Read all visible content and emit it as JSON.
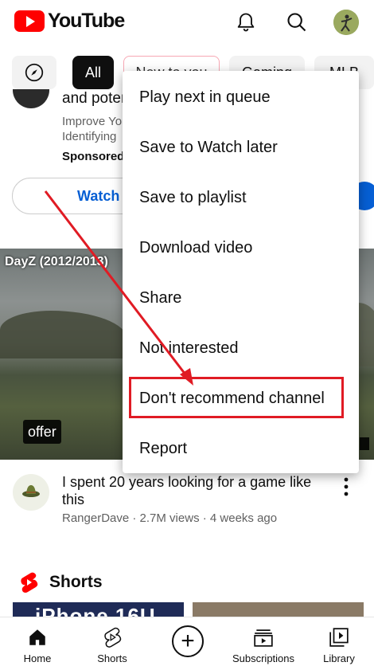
{
  "header": {
    "logo_text": "YouTube"
  },
  "chips": {
    "all": "All",
    "new": "New to you",
    "gaming": "Gaming",
    "mlb": "MLB"
  },
  "ad": {
    "title": "and poter",
    "desc": "Improve Yo Identifying",
    "sponsored": "Sponsored",
    "watch": "Watch"
  },
  "video": {
    "thumb_title": "DayZ (2012/2013)",
    "badge": "offer",
    "title": "I spent 20 years looking for a game like this",
    "meta": "RangerDave · 2.7M views · 4 weeks ago"
  },
  "shorts": {
    "label": "Shorts",
    "thumb_text": "iPhone 16U"
  },
  "nav": {
    "home": "Home",
    "shorts": "Shorts",
    "subscriptions": "Subscriptions",
    "library": "Library"
  },
  "menu": {
    "items": [
      "Play next in queue",
      "Save to Watch later",
      "Save to playlist",
      "Download video",
      "Share",
      "Not interested",
      "Don't recommend channel",
      "Report"
    ]
  },
  "colors": {
    "brand": "#ff0000",
    "annotation": "#e01b24",
    "link": "#065fd4"
  },
  "icons": [
    "youtube-logo-icon",
    "bell-icon",
    "search-icon",
    "compass-icon",
    "more-vert-icon",
    "shorts-icon",
    "home-icon",
    "create-icon",
    "subscriptions-icon",
    "library-icon"
  ]
}
